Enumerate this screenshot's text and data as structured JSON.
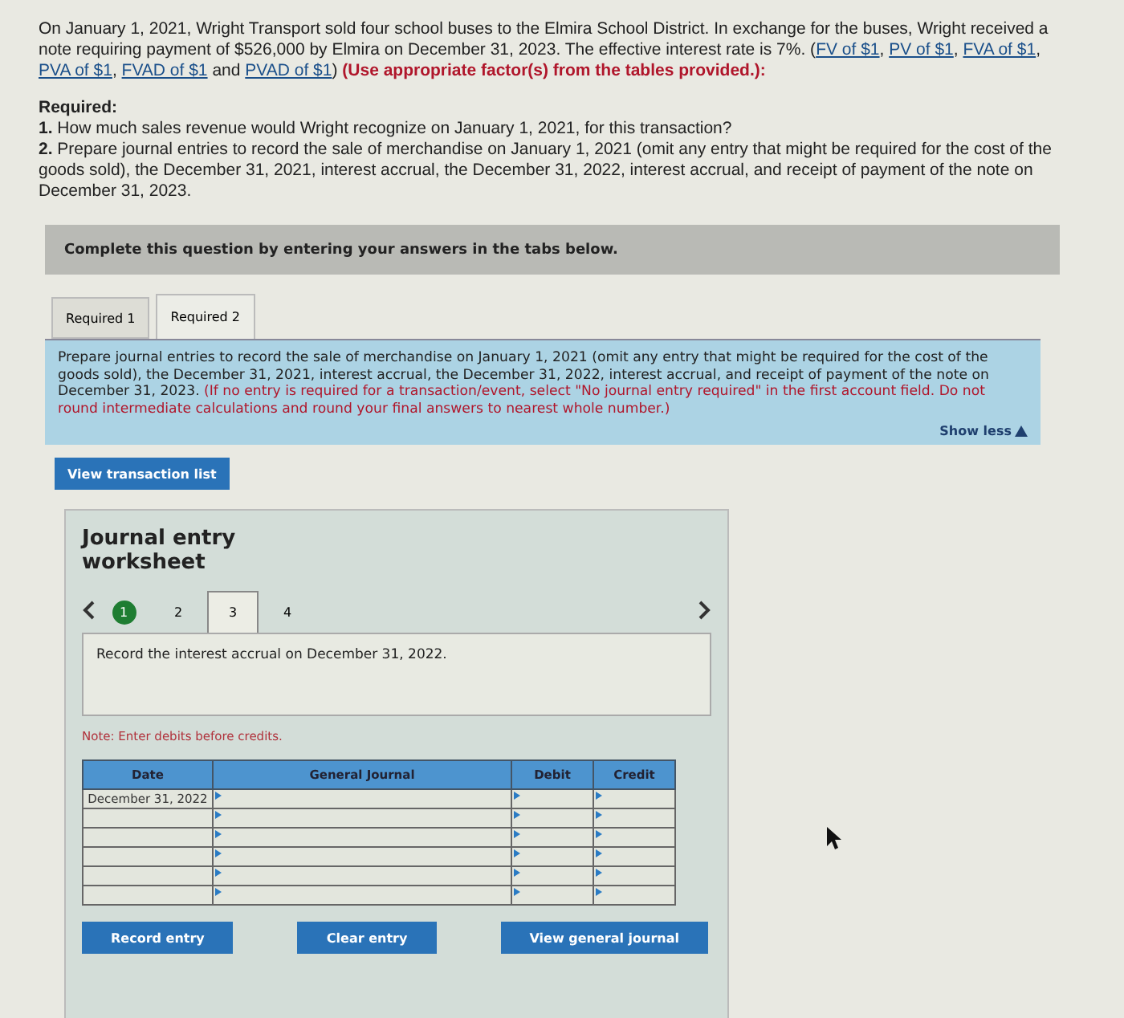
{
  "intro": [
    {
      "kind": "text",
      "text": "On January 1, 2021, Wright Transport sold four school buses to the Elmira School District. In exchange for the buses, Wright received a note requiring payment of $526,000 by Elmira on December 31, 2023. The effective interest rate is 7%. ("
    },
    {
      "kind": "link",
      "text": "FV of $1"
    },
    {
      "kind": "text",
      "text": ", "
    },
    {
      "kind": "link",
      "text": "PV of $1"
    },
    {
      "kind": "text",
      "text": ", "
    },
    {
      "kind": "link",
      "text": "FVA of $1"
    },
    {
      "kind": "text",
      "text": ", "
    },
    {
      "kind": "link",
      "text": "PVA of $1"
    },
    {
      "kind": "text",
      "text": ", "
    },
    {
      "kind": "link",
      "text": "FVAD of $1"
    },
    {
      "kind": "text",
      "text": " and "
    },
    {
      "kind": "link",
      "text": "PVAD of $1"
    },
    {
      "kind": "text",
      "text": ") "
    },
    {
      "kind": "alert",
      "text": "(Use appropriate factor(s) from the tables provided.):"
    }
  ],
  "required": {
    "title": "Required:",
    "items": [
      "**1.** How much sales revenue would Wright recognize on January 1, 2021, for this transaction?",
      "**2.** Prepare journal entries to record the sale of merchandise on January 1, 2021 (omit any entry that might be required for the cost of the goods sold), the December 31, 2021, interest accrual, the December 31, 2022, interest accrual, and receipt of payment of the note on December 31, 2023."
    ]
  },
  "banner": "Complete this question by entering your answers in the tabs below.",
  "tabs": [
    {
      "label": "Required 1",
      "selected": false
    },
    {
      "label": "Required 2",
      "selected": true
    }
  ],
  "instructions": [
    {
      "kind": "text",
      "text": "Prepare journal entries to record the sale of merchandise on January 1, 2021 (omit any entry that might be required for the cost of the goods sold), the December 31, 2021, interest accrual, the December 31, 2022, interest accrual, and receipt of payment of the note on December 31, 2023. "
    },
    {
      "kind": "alert",
      "text": "(If no entry is required for a transaction/event, select \"No journal entry required\" in the first account field. Do not round intermediate calculations and round your final answers to nearest whole number.)"
    }
  ],
  "show_less": "Show less",
  "view_transactions": "View transaction list",
  "worksheet": {
    "title": "Journal entry worksheet",
    "steps": [
      {
        "label": "1",
        "done": true,
        "selected": false
      },
      {
        "label": "2",
        "done": false,
        "selected": false
      },
      {
        "label": "3",
        "done": false,
        "selected": true
      },
      {
        "label": "4",
        "done": false,
        "selected": false
      }
    ],
    "prompt": "Record the interest accrual on December 31, 2022.",
    "note": "Note: Enter debits before credits.",
    "columns": [
      "Date",
      "General Journal",
      "Debit",
      "Credit"
    ],
    "rows": [
      {
        "date": "December 31, 2022"
      },
      {},
      {},
      {},
      {},
      {}
    ],
    "buttons": [
      "Record entry",
      "Clear entry",
      "View general journal"
    ]
  }
}
